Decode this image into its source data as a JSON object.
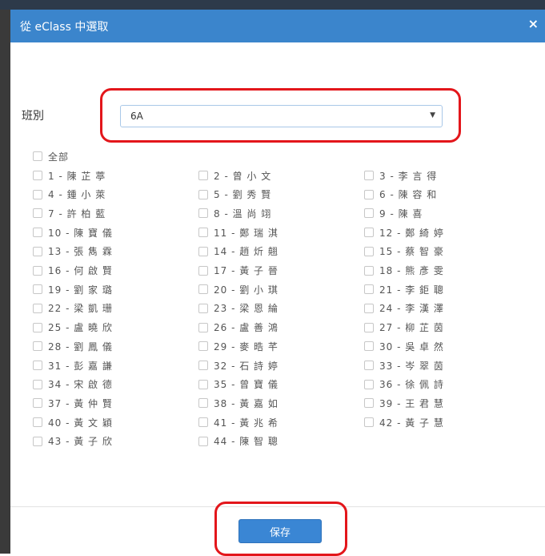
{
  "dialog": {
    "title": "從 eClass 中選取",
    "close_icon": "×",
    "class_label": "班別",
    "class_value": "6A",
    "caret_icon": "▼",
    "select_all_label": "全部",
    "save_label": "保存"
  },
  "students": [
    "1 - 陳 芷 葶",
    "2 - 曾 小 文",
    "3 - 李 言 得",
    "4 - 鍾 小 萊",
    "5 - 劉 秀 賢",
    "6 - 陳 容 和",
    "7 - 許 柏 藍",
    "8 - 溫 尚 翊",
    "9 - 陳 喜",
    "10 - 陳 寶 儀",
    "11 - 鄭 瑞 淇",
    "12 - 鄭 綺 婷",
    "13 - 張 雋 霖",
    "14 - 趙 炘 翹",
    "15 - 蔡 智 豪",
    "16 - 何 啟 賢",
    "17 - 黃 子 晉",
    "18 - 熊 彥 雯",
    "19 - 劉 家 璐",
    "20 - 劉 小 琪",
    "21 - 李 鉅 聰",
    "22 - 梁 凱 珊",
    "23 - 梁 恩 綸",
    "24 - 李 漢 澤",
    "25 - 盧 曉 欣",
    "26 - 盧 善 鴻",
    "27 - 柳 芷 茵",
    "28 - 劉 鳳 儀",
    "29 - 麥 晧 芊",
    "30 - 吳 卓 然",
    "31 - 彭 嘉 謙",
    "32 - 石 詩 婷",
    "33 - 岑 翠 茵",
    "34 - 宋 啟 德",
    "35 - 曾 寶 儀",
    "36 - 徐 佩 詩",
    "37 - 黃 仲 賢",
    "38 - 黃 嘉 如",
    "39 - 王 君 慧",
    "40 - 黃 文 穎",
    "41 - 黃 兆 希",
    "42 - 黃 子 慧",
    "43 - 黃 子 欣",
    "44 - 陳 智 聰"
  ],
  "colors": {
    "header": "#3b85cc",
    "highlight": "#e3161b",
    "save_button": "#3a86d4"
  }
}
